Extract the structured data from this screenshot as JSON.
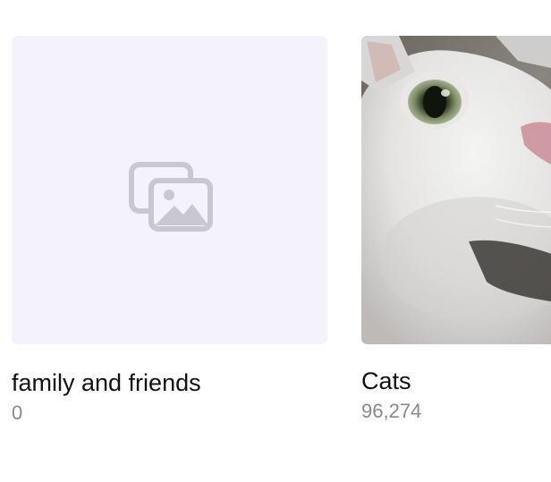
{
  "albums": [
    {
      "title": "family and friends",
      "count": "0",
      "thumbnail": "empty-album-placeholder-icon"
    },
    {
      "title": "Cats",
      "count": "96,274",
      "thumbnail": "cat-photo"
    }
  ],
  "colors": {
    "placeholder_bg": "#f4f2fb",
    "placeholder_icon": "#c9c7cf",
    "title_text": "#111111",
    "count_text": "#8a8a8e"
  }
}
